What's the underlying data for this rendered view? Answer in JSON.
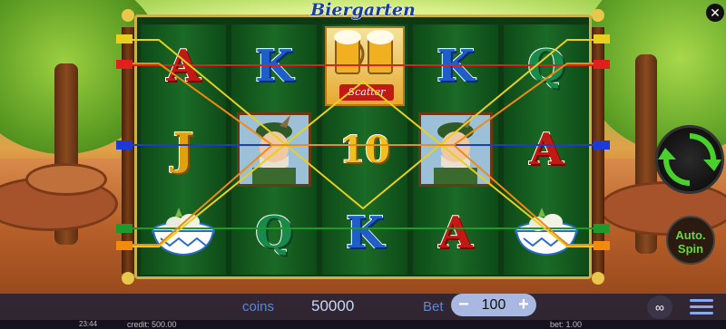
{
  "game": {
    "title": "Biergarten"
  },
  "reels": [
    [
      "A",
      "J",
      "bowl"
    ],
    [
      "K",
      "hunter",
      "Q"
    ],
    [
      "scatter",
      "10",
      "K"
    ],
    [
      "K",
      "hunter",
      "A"
    ],
    [
      "Q",
      "A",
      "bowl"
    ]
  ],
  "scatter_label": "Scatter",
  "controls": {
    "coins_label": "coins",
    "coins_value": "50000",
    "bet_label": "Bet",
    "bet_value": "100",
    "bet_minus": "−",
    "bet_plus": "+",
    "close": "✕",
    "autospin": "Auto. Spin",
    "infinity": "∞"
  },
  "status": {
    "clock": "23:44",
    "credit": "credit: 500.00",
    "bet": "bet: 1.00"
  },
  "colors": {
    "line_red": "#e0201a",
    "line_blue": "#1c3ad8",
    "line_green": "#1c9a2a",
    "line_orange": "#f08a10",
    "line_yellow": "#e8d020"
  }
}
